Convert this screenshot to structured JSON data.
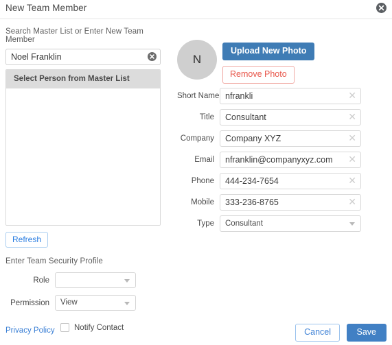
{
  "header": {
    "title": "New Team Member",
    "close_icon": "close-circle-icon"
  },
  "left": {
    "search_label": "Search Master List or Enter New Team Member",
    "search_value": "Noel Franklin",
    "search_placeholder": "",
    "search_clear_icon": "clear-circle-icon",
    "master_list_header": "Select Person from Master List",
    "refresh_label": "Refresh",
    "security_label": "Enter Team Security Profile",
    "role": {
      "label": "Role",
      "value": "",
      "caret_icon": "chevron-down-icon"
    },
    "permission": {
      "label": "Permission",
      "value": "View",
      "caret_icon": "chevron-down-icon"
    },
    "notify": {
      "label": "Notify Contact",
      "checked": false
    },
    "privacy_link": "Privacy Policy"
  },
  "right": {
    "avatar_initial": "N",
    "upload_label": "Upload New Photo",
    "remove_label": "Remove Photo",
    "fields": [
      {
        "label": "Short Name",
        "value": "nfrankli",
        "clear_icon": "clear-x-icon"
      },
      {
        "label": "Title",
        "value": "Consultant",
        "clear_icon": "clear-x-icon"
      },
      {
        "label": "Company",
        "value": "Company XYZ",
        "clear_icon": "clear-x-icon"
      },
      {
        "label": "Email",
        "value": "nfranklin@companyxyz.com",
        "clear_icon": "clear-x-icon"
      },
      {
        "label": "Phone",
        "value": "444-234-7654",
        "clear_icon": "clear-x-icon"
      },
      {
        "label": "Mobile",
        "value": "333-236-8765",
        "clear_icon": "clear-x-icon"
      }
    ],
    "type": {
      "label": "Type",
      "value": "Consultant",
      "caret_icon": "chevron-down-icon"
    }
  },
  "footer": {
    "cancel_label": "Cancel",
    "save_label": "Save"
  },
  "colors": {
    "primary_blue": "#3f7cb5",
    "link_blue": "#3a7fd5",
    "danger_red": "#e8564a",
    "list_header_gray": "#dcdcdc",
    "avatar_gray": "#cfcfcf"
  }
}
